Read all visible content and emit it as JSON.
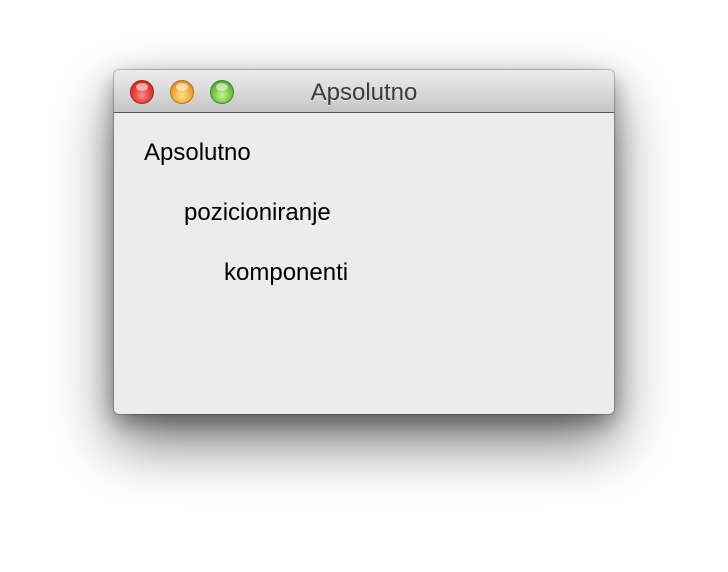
{
  "window": {
    "title": "Apsolutno"
  },
  "content": {
    "labels": [
      "Apsolutno",
      "pozicioniranje",
      "komponenti"
    ]
  },
  "colors": {
    "window_background": "#ececec",
    "close_button": "#e8433c",
    "minimize_button": "#f2b23e",
    "zoom_button": "#79c94a"
  },
  "icons": {
    "close": "close-button-icon",
    "minimize": "minimize-button-icon",
    "zoom": "zoom-button-icon"
  }
}
